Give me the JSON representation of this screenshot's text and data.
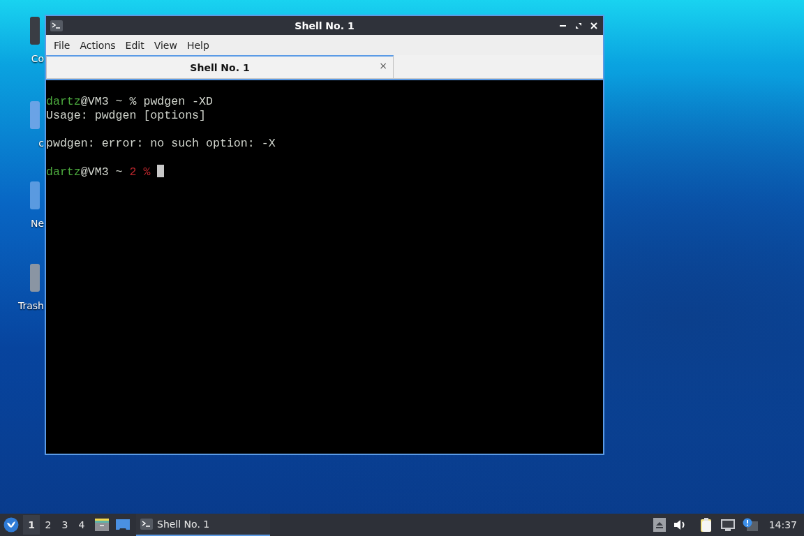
{
  "desktop_icons": [
    {
      "label": "Co"
    },
    {
      "label": "c"
    },
    {
      "label": "Ne"
    },
    {
      "label": "Trash"
    }
  ],
  "window": {
    "title": "Shell No. 1"
  },
  "menu": [
    "File",
    "Actions",
    "Edit",
    "View",
    "Help"
  ],
  "tabs": [
    {
      "label": "Shell No. 1",
      "selected": true,
      "close": "×"
    }
  ],
  "terminal": {
    "lines": [
      {
        "gap_before": false,
        "segments": [
          {
            "text": "dartz",
            "color": "#4caa3e"
          },
          {
            "text": "@VM3 ~ % pwdgen -XD",
            "color": "#d3d7cf"
          }
        ]
      },
      {
        "gap_before": false,
        "segments": [
          {
            "text": "Usage: pwdgen [options]",
            "color": "#d3d7cf"
          }
        ]
      },
      {
        "gap_before": true,
        "segments": [
          {
            "text": "pwdgen: error: no such option: -X",
            "color": "#d3d7cf"
          }
        ]
      },
      {
        "gap_before": true,
        "segments": [
          {
            "text": "dartz",
            "color": "#4caa3e"
          },
          {
            "text": "@VM3 ~ ",
            "color": "#d3d7cf"
          },
          {
            "text": "2 %",
            "color": "#b8262c"
          }
        ]
      }
    ],
    "cursor": true
  },
  "taskbar": {
    "workspaces": [
      {
        "label": "1",
        "selected": true
      },
      {
        "label": "2",
        "selected": false
      },
      {
        "label": "3",
        "selected": false
      },
      {
        "label": "4",
        "selected": false
      }
    ],
    "tasks": [
      {
        "label": "Shell No. 1",
        "selected": true
      }
    ],
    "clock": "14:37"
  }
}
